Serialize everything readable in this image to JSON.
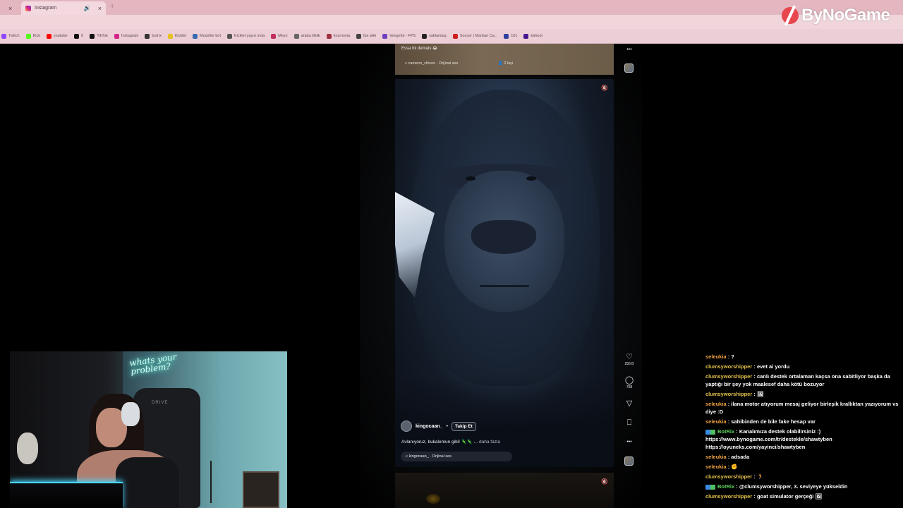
{
  "browser": {
    "tab_first_label": "",
    "tab_active_label": "Instagram",
    "new_tab_symbol": "+",
    "close_symbol": "×",
    "bookmarks": [
      {
        "label": "Twitch",
        "color": "#9146ff"
      },
      {
        "label": "Kick",
        "color": "#53fc18"
      },
      {
        "label": "youtube",
        "color": "#ff0000"
      },
      {
        "label": "X",
        "color": "#111111"
      },
      {
        "label": "TikTok",
        "color": "#111111"
      },
      {
        "label": "Instagram",
        "color": "#d6248a"
      },
      {
        "label": "botrix",
        "color": "#333333"
      },
      {
        "label": "Kicklet",
        "color": "#e8c020"
      },
      {
        "label": "Mossfire bot",
        "color": "#3a6ab0"
      },
      {
        "label": "Kicklet yayın ında",
        "color": "#555555"
      },
      {
        "label": "Meyo",
        "color": "#c03060"
      },
      {
        "label": "araba ilikiik",
        "color": "#666666"
      },
      {
        "label": "kozmoyia",
        "color": "#a03040"
      },
      {
        "label": "fps wiki",
        "color": "#444444"
      },
      {
        "label": "Vengeful - FPS",
        "color": "#7040c0"
      },
      {
        "label": "saklandaş",
        "color": "#222222"
      },
      {
        "label": "Soccer | Marban Ca...",
        "color": "#cc2020"
      },
      {
        "label": "101",
        "color": "#3040a0"
      },
      {
        "label": "kahoot",
        "color": "#46178f"
      }
    ]
  },
  "logo": {
    "text": "ByNoGame"
  },
  "prev_reel": {
    "caption": "Essa foi demais 😂",
    "audio": "cameiro_chicoo · Orijinal ses",
    "people": "2 kişi"
  },
  "reel": {
    "username": "kingocaan_",
    "dot": "•",
    "follow_label": "Takip Et",
    "caption": "Avlanıyoruz, bukalemun gibi! 🦎🦎 ...",
    "more_label": "daha fazla",
    "audio": "kingocaan_ · Orijinal ses"
  },
  "actions": {
    "likes": "256 B",
    "comments": "758",
    "more": "•••"
  },
  "webcam": {
    "neon_text": "whats your problem?",
    "chair_brand": "DRIVE"
  },
  "chat": [
    {
      "user": "seleukia",
      "color": "orange",
      "text": "?",
      "badges": false
    },
    {
      "user": "clumsyworshipper",
      "color": "yellow",
      "text": "evet ai yordu",
      "badges": false
    },
    {
      "user": "clumsyworshipper",
      "color": "yellow",
      "text": "canlı destek ortalaman kaçsa ona sabitliyor başka da yaptığı bir şey yok maalesef daha kötü bozuyor",
      "badges": false
    },
    {
      "user": "clumsyworshipper",
      "color": "yellow",
      "text": "🖼",
      "badges": false
    },
    {
      "user": "seleukia",
      "color": "orange",
      "text": "ilana motor atıyorum mesaj geliyor birleşik krallıktan yazıyorum vs diye :D",
      "badges": false
    },
    {
      "user": "seleukia",
      "color": "orange",
      "text": "sahibinden de bile fake hesap var",
      "badges": false
    },
    {
      "user": "BotRix",
      "color": "green",
      "text": "Kanalımıza destek olabilirsiniz :) https://www.bynogame.com/tr/destekle/shawtyben https://oyuneks.com/yayinci/shawtyben",
      "badges": true
    },
    {
      "user": "seleukia",
      "color": "orange",
      "text": "adsada",
      "badges": false
    },
    {
      "user": "seleukia",
      "color": "orange",
      "text": "✊",
      "badges": false
    },
    {
      "user": "clumsyworshipper",
      "color": "yellow",
      "text": "🏃",
      "badges": false
    },
    {
      "user": "BotRix",
      "color": "green",
      "text": "@clumsyworshipper, 3. seviyeye yükseldin",
      "badges": true
    },
    {
      "user": "clumsyworshipper",
      "color": "yellow",
      "text": "goat simulator gerçeği 🖼",
      "badges": false
    }
  ]
}
